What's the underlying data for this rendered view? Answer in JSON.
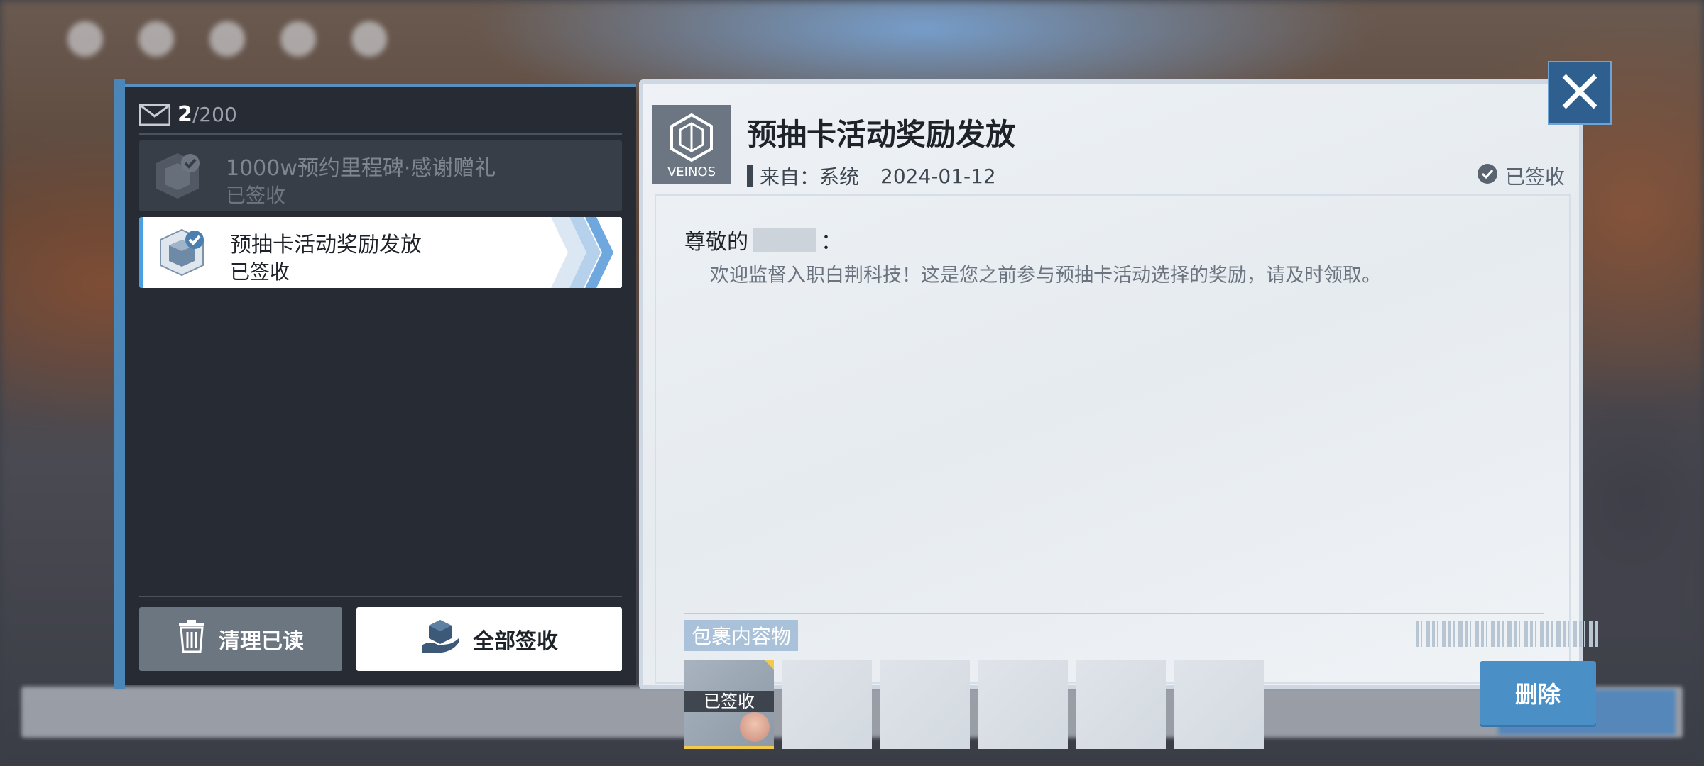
{
  "mailbox": {
    "count_current": "2",
    "count_total": "/200",
    "items": [
      {
        "title": "1000w预约里程碑·感谢赠礼",
        "status": "已签收"
      },
      {
        "title": "预抽卡活动奖励发放",
        "status": "已签收"
      }
    ],
    "clear_read_label": "清理已读",
    "claim_all_label": "全部签收"
  },
  "mail": {
    "subject": "预抽卡活动奖励发放",
    "from_label": "来自：系统",
    "date": "2024-01-12",
    "status": "已签收",
    "greeting_prefix": "尊敬的",
    "greeting_suffix": "：",
    "message": "欢迎监督入职白荆科技！这是您之前参与预抽卡活动选择的奖励，请及时领取。",
    "attachments_label": "包裹内容物",
    "attachment_claimed_label": "已签收",
    "delete_label": "删除"
  },
  "colors": {
    "accent": "#4a8fc6",
    "panel_dark": "#262b34",
    "panel_light": "#eef2f6"
  }
}
